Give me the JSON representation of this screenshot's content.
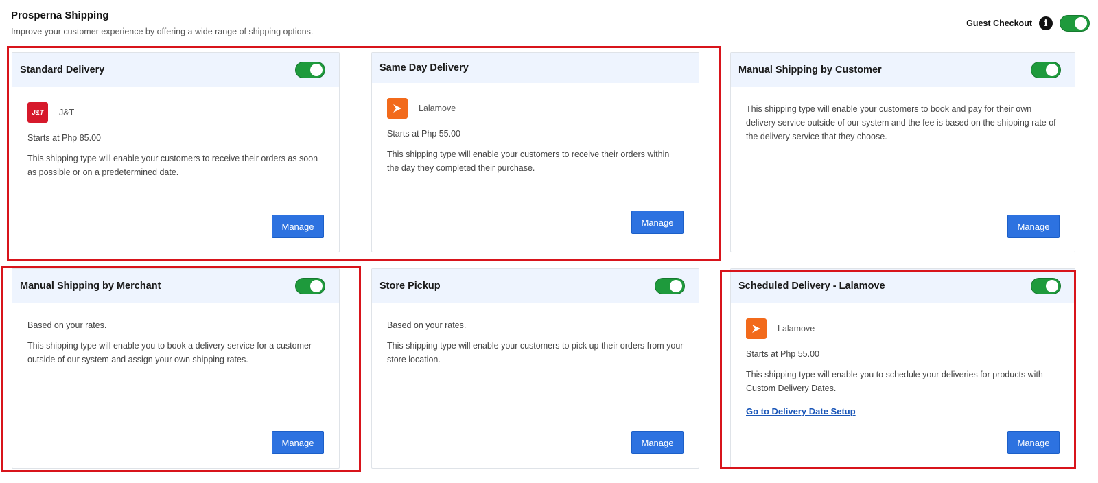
{
  "header": {
    "title": "Prosperna Shipping",
    "subtitle": "Improve your customer experience by offering a wide range of shipping options."
  },
  "guest_checkout": {
    "label": "Guest Checkout",
    "info_symbol": "i",
    "enabled": true
  },
  "manage_label": "Manage",
  "cards": [
    {
      "title": "Standard Delivery",
      "enabled": true,
      "courier": "J&T",
      "courier_logo_text": "J&T",
      "price": "Starts at Php 85.00",
      "description": "This shipping type will enable your customers to receive their orders as soon as possible or on a predetermined date."
    },
    {
      "title": "Same Day Delivery",
      "courier": "Lalamove",
      "courier_logo_text": "LALAMOVE",
      "price": "Starts at Php 55.00",
      "description": "This shipping type will enable your customers to receive their orders within the day they completed their purchase."
    },
    {
      "title": "Manual Shipping by Customer",
      "enabled": true,
      "description": "This shipping type will enable your customers to book and pay for their own delivery service outside of our system and the fee is based on the shipping rate of the delivery service that they choose."
    },
    {
      "title": "Manual Shipping by Merchant",
      "enabled": true,
      "rates": "Based on your rates.",
      "description": "This shipping type will enable you to book a delivery service for a customer outside of our system and assign your own shipping rates."
    },
    {
      "title": "Store Pickup",
      "enabled": true,
      "rates": "Based on your rates.",
      "description": "This shipping type will enable your customers to pick up their orders from your store location."
    },
    {
      "title": "Scheduled Delivery - Lalamove",
      "enabled": true,
      "courier": "Lalamove",
      "courier_logo_text": "LALAMOVE",
      "price": "Starts at Php 55.00",
      "description": "This shipping type will enable you to schedule your deliveries for products with Custom Delivery Dates.",
      "link": "Go to Delivery Date Setup"
    }
  ],
  "colors": {
    "toggle_on": "#1e9a3c",
    "button": "#2d72e0",
    "card_header": "#eef4fe",
    "highlight": "#d8141b",
    "jt_brand": "#d6192b",
    "lalamove_brand": "#f26a1b"
  }
}
